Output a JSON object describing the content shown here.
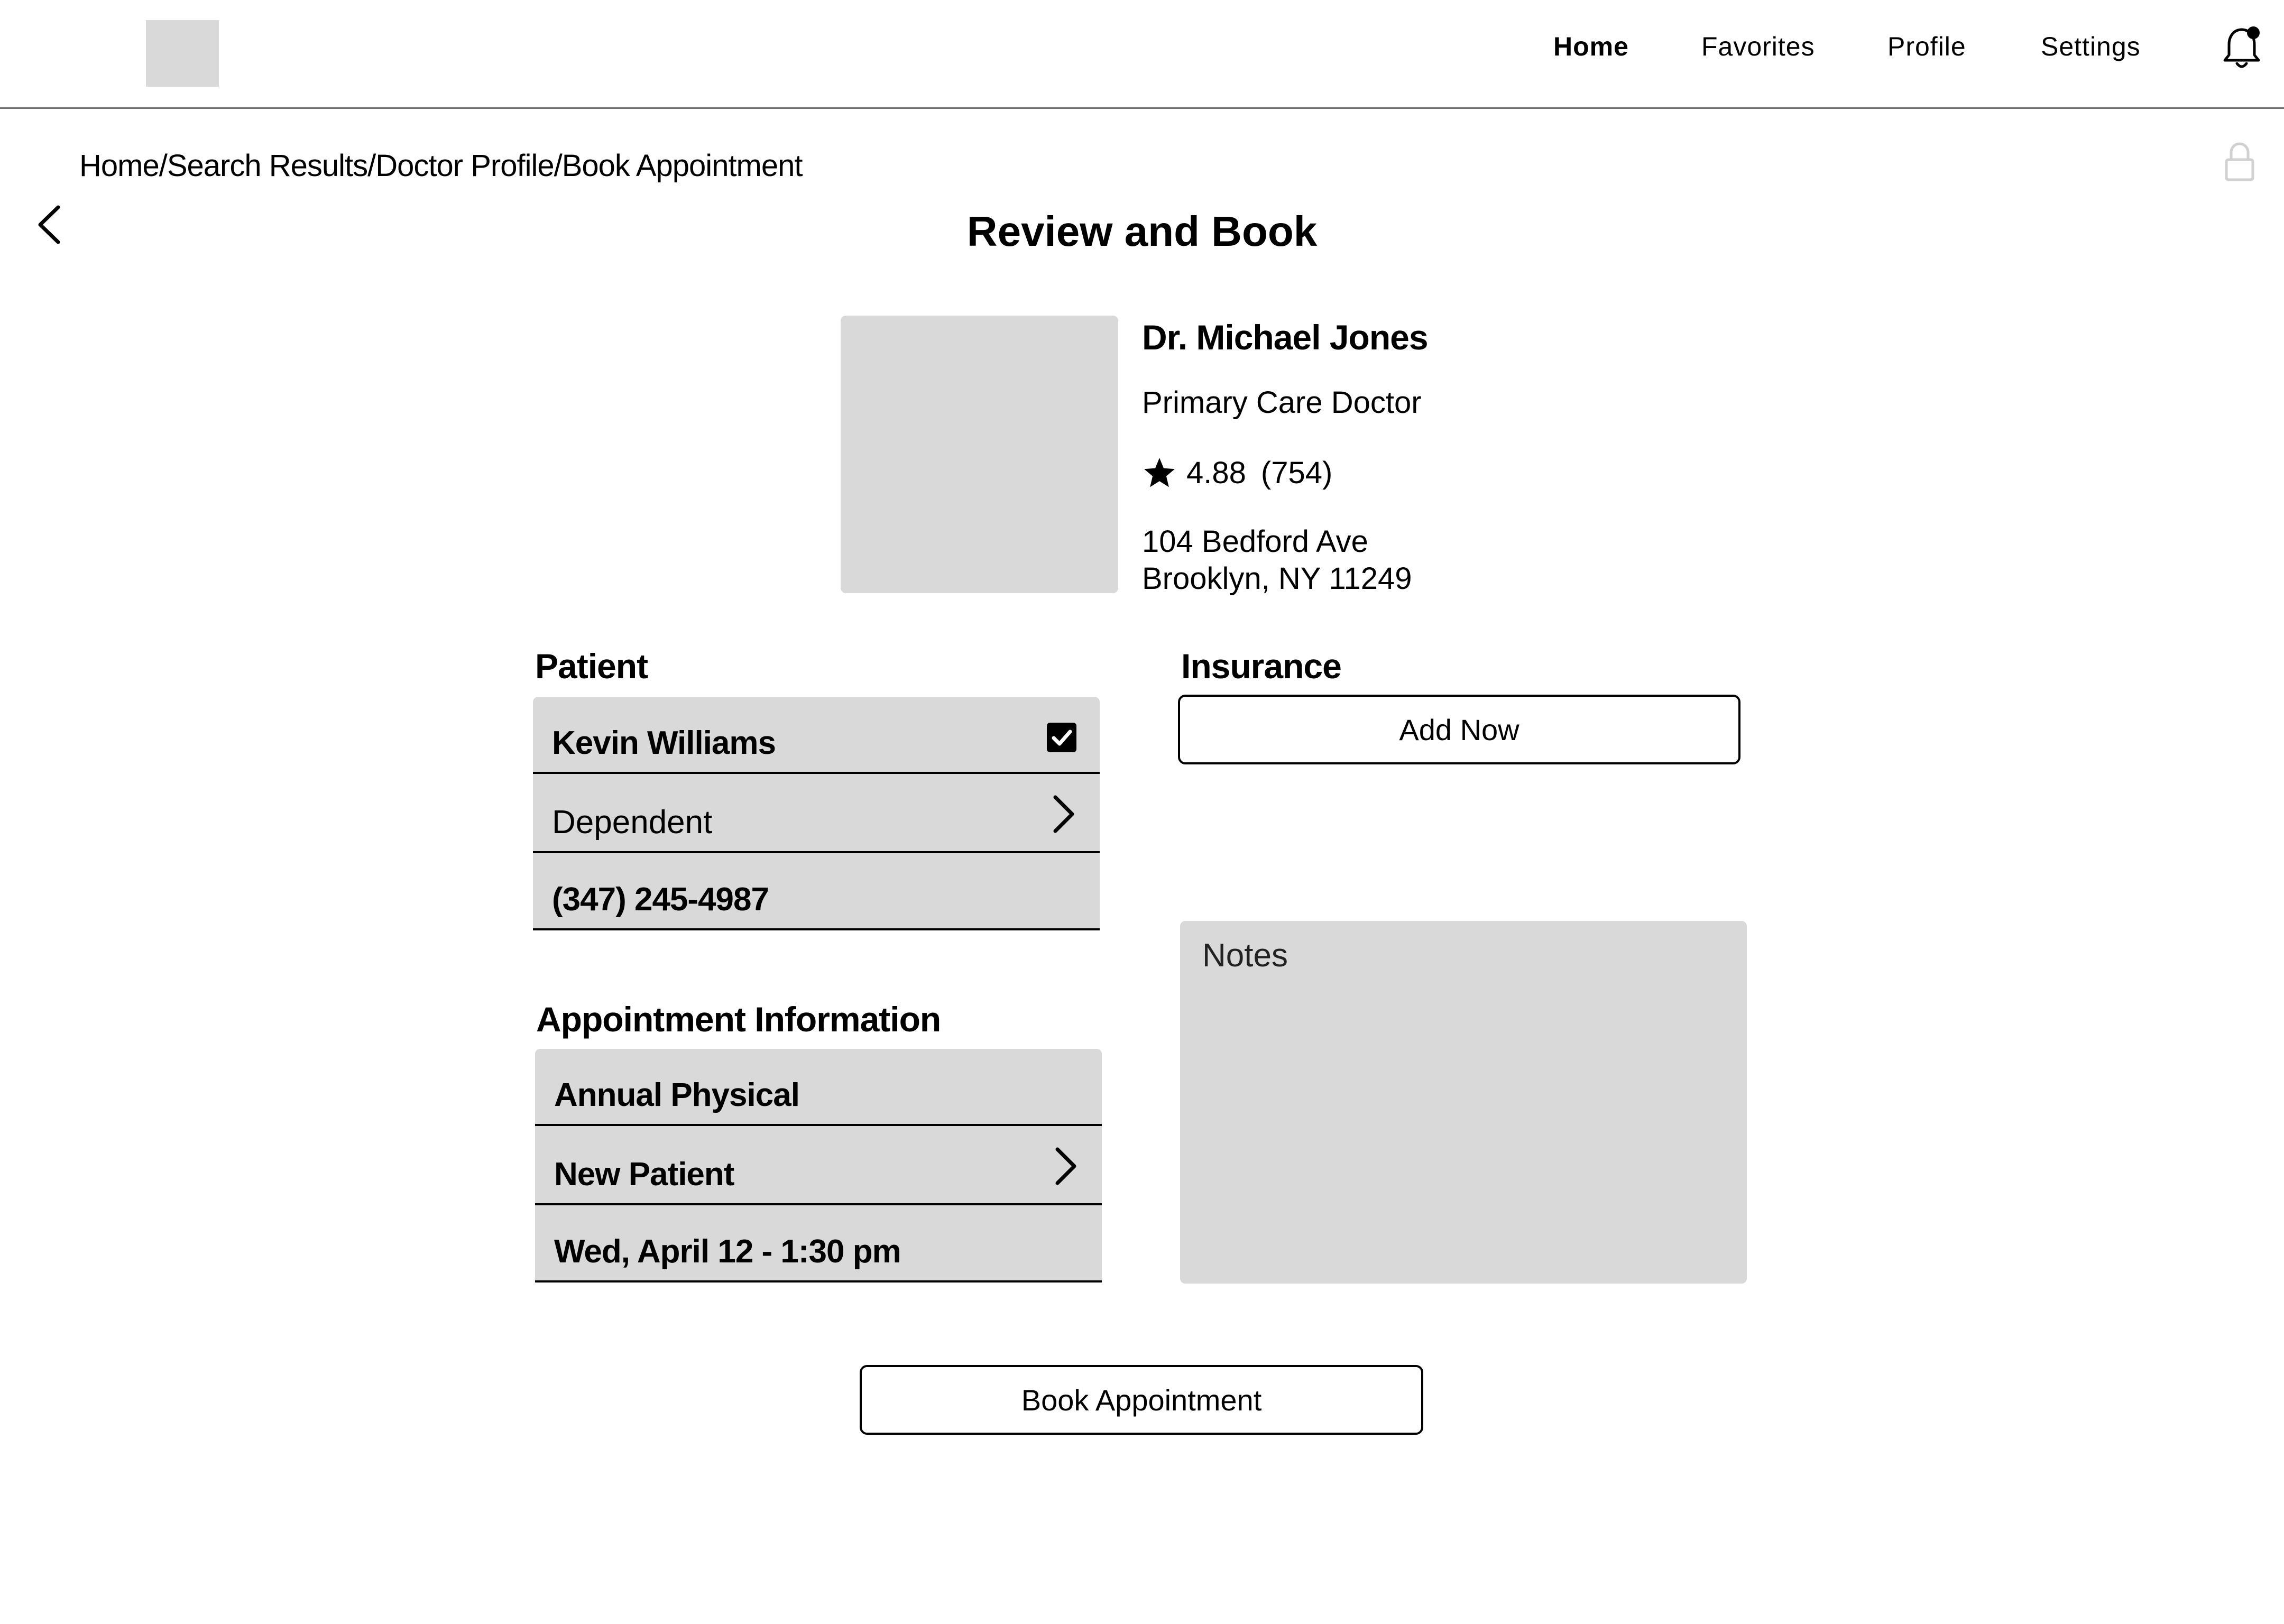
{
  "header": {
    "nav": [
      {
        "label": "Home",
        "active": true
      },
      {
        "label": "Favorites",
        "active": false
      },
      {
        "label": "Profile",
        "active": false
      },
      {
        "label": "Settings",
        "active": false
      }
    ]
  },
  "breadcrumb": {
    "items": [
      "Home",
      "Search Results",
      "Doctor Profile",
      "Book Appointment"
    ],
    "separator": "/"
  },
  "page": {
    "title": "Review and Book"
  },
  "doctor": {
    "name": "Dr. Michael Jones",
    "specialty": "Primary Care Doctor",
    "rating": "4.88",
    "review_count": "(754)",
    "address_line1": "104 Bedford Ave",
    "address_line2": "Brooklyn, NY 11249"
  },
  "patient": {
    "section_title": "Patient",
    "name": "Kevin Williams",
    "selected": true,
    "relationship": "Dependent",
    "phone": "(347) 245-4987"
  },
  "insurance": {
    "section_title": "Insurance",
    "add_button_label": "Add Now"
  },
  "appointment": {
    "section_title": "Appointment Information",
    "type": "Annual Physical",
    "patient_status": "New Patient",
    "datetime": "Wed, April 12 - 1:30 pm"
  },
  "notes": {
    "placeholder": "Notes"
  },
  "actions": {
    "book_label": "Book Appointment"
  },
  "colors": {
    "placeholder_gray": "#d9d9d9",
    "divider_gray": "#6f6f6f",
    "text": "#000000"
  }
}
